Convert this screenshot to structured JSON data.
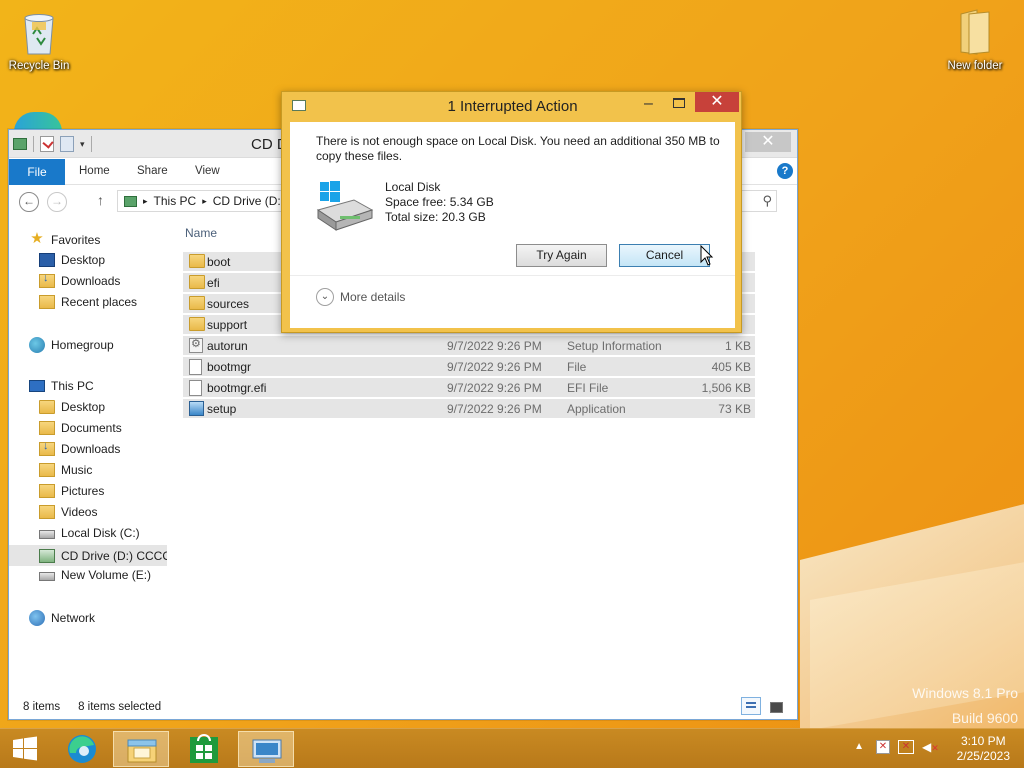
{
  "desktop": {
    "icons": [
      {
        "label": "Recycle Bin",
        "icon": "recycle-bin-icon"
      },
      {
        "label": "New folder",
        "icon": "folder-icon"
      }
    ],
    "watermark_line1": "Windows 8.1 Pro",
    "watermark_line2": "Build 9600"
  },
  "explorer": {
    "title": "CD D",
    "ribbon": {
      "file": "File",
      "home": "Home",
      "share": "Share",
      "view": "View",
      "help": "?"
    },
    "address": {
      "crumb1": "This PC",
      "crumb2": "CD Drive (D:"
    },
    "nav": {
      "favorites": "Favorites",
      "desktop": "Desktop",
      "downloads": "Downloads",
      "recent": "Recent places",
      "homegroup": "Homegroup",
      "this_pc": "This PC",
      "pc_desktop": "Desktop",
      "pc_documents": "Documents",
      "pc_downloads": "Downloads",
      "pc_music": "Music",
      "pc_pictures": "Pictures",
      "pc_videos": "Videos",
      "local_disk": "Local Disk (C:)",
      "cd_drive": "CD Drive (D:) CCCOI",
      "new_volume": "New Volume (E:)",
      "network": "Network"
    },
    "column_name": "Name",
    "rows": [
      {
        "name": "boot",
        "date": "",
        "type": "",
        "size": "",
        "kind": "folder"
      },
      {
        "name": "efi",
        "date": "",
        "type": "",
        "size": "",
        "kind": "folder"
      },
      {
        "name": "sources",
        "date": "",
        "type": "",
        "size": "",
        "kind": "folder"
      },
      {
        "name": "support",
        "date": "",
        "type": "",
        "size": "",
        "kind": "folder"
      },
      {
        "name": "autorun",
        "date": "9/7/2022 9:26 PM",
        "type": "Setup Information",
        "size": "1 KB",
        "kind": "inf"
      },
      {
        "name": "bootmgr",
        "date": "9/7/2022 9:26 PM",
        "type": "File",
        "size": "405 KB",
        "kind": "file"
      },
      {
        "name": "bootmgr.efi",
        "date": "9/7/2022 9:26 PM",
        "type": "EFI File",
        "size": "1,506 KB",
        "kind": "file"
      },
      {
        "name": "setup",
        "date": "9/7/2022 9:26 PM",
        "type": "Application",
        "size": "73 KB",
        "kind": "setup"
      }
    ],
    "status_items": "8 items",
    "status_selected": "8 items selected"
  },
  "dialog": {
    "title": "1 Interrupted Action",
    "message": "There is not enough space on Local Disk. You need an additional 350 MB to copy these files.",
    "disk_name": "Local Disk",
    "space_free": "Space free: 5.34 GB",
    "total_size": "Total size: 20.3 GB",
    "try_again": "Try Again",
    "cancel": "Cancel",
    "more_details": "More details"
  },
  "taskbar": {
    "time": "3:10 PM",
    "date": "2/25/2023",
    "apps": [
      "start-button",
      "edge-icon",
      "file-explorer-icon",
      "store-icon",
      "setup-app-icon"
    ]
  }
}
